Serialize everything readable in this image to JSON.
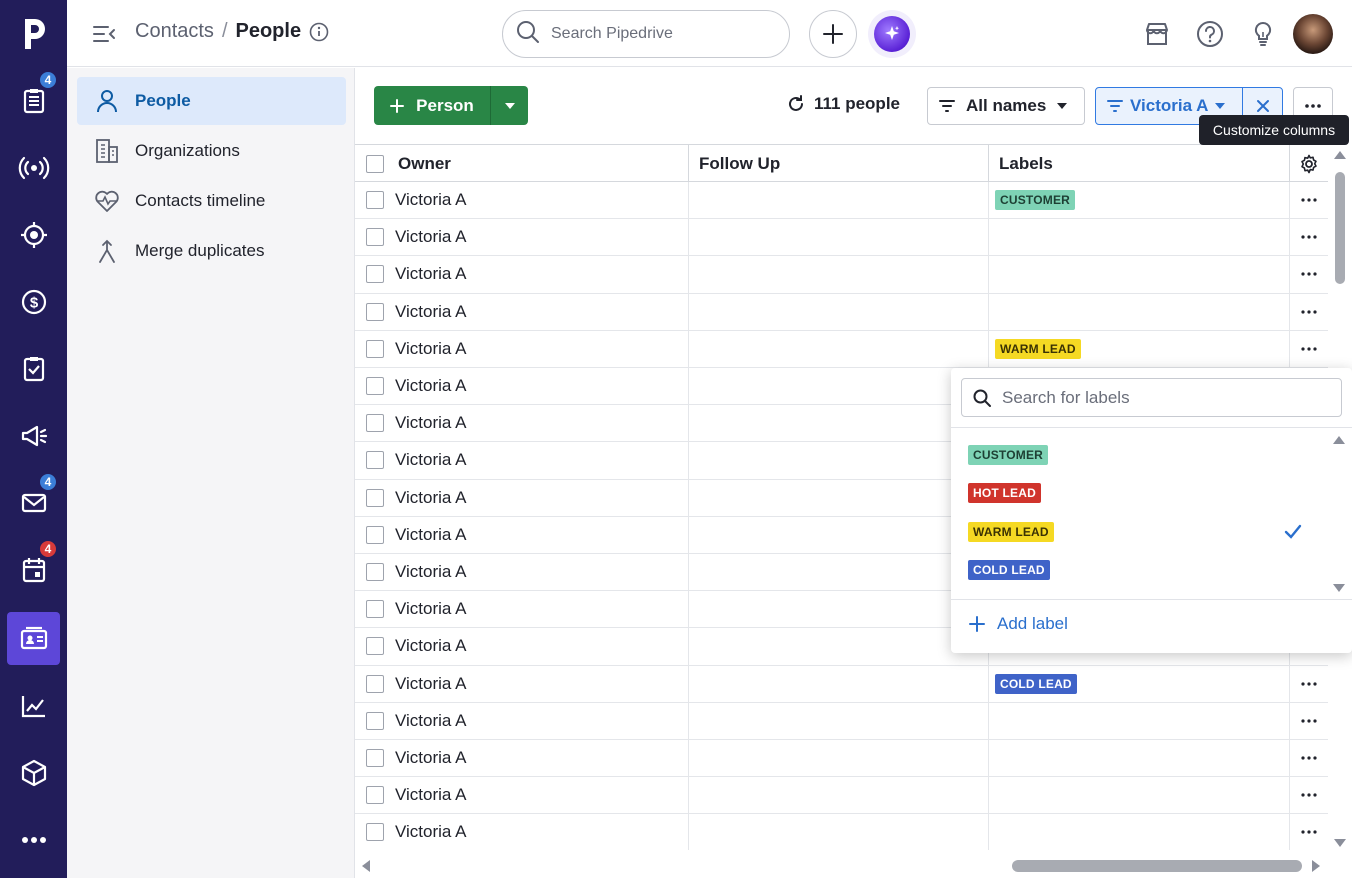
{
  "header": {
    "breadcrumb_parent": "Contacts",
    "breadcrumb_sep": "/",
    "breadcrumb_current": "People",
    "search_placeholder": "Search Pipedrive"
  },
  "rail": {
    "badges": {
      "activities": "4",
      "mail": "4",
      "calendar": "4"
    }
  },
  "sidebar": {
    "items": [
      {
        "label": "People",
        "icon": "person-icon"
      },
      {
        "label": "Organizations",
        "icon": "building-icon"
      },
      {
        "label": "Contacts timeline",
        "icon": "heartbeat-icon"
      },
      {
        "label": "Merge duplicates",
        "icon": "merge-icon"
      }
    ]
  },
  "toolbar": {
    "add_label": "Person",
    "count_label": "111 people",
    "names_filter": "All names",
    "owner_filter": "Victoria A",
    "tooltip": "Customize columns"
  },
  "table": {
    "columns": [
      "Owner",
      "Follow Up",
      "Labels"
    ],
    "rows": [
      {
        "owner": "Victoria A",
        "label": "CUSTOMER"
      },
      {
        "owner": "Victoria A",
        "label": ""
      },
      {
        "owner": "Victoria A",
        "label": ""
      },
      {
        "owner": "Victoria A",
        "label": ""
      },
      {
        "owner": "Victoria A",
        "label": "WARM LEAD"
      },
      {
        "owner": "Victoria A",
        "label": ""
      },
      {
        "owner": "Victoria A",
        "label": ""
      },
      {
        "owner": "Victoria A",
        "label": ""
      },
      {
        "owner": "Victoria A",
        "label": ""
      },
      {
        "owner": "Victoria A",
        "label": ""
      },
      {
        "owner": "Victoria A",
        "label": ""
      },
      {
        "owner": "Victoria A",
        "label": ""
      },
      {
        "owner": "Victoria A",
        "label": ""
      },
      {
        "owner": "Victoria A",
        "label": "COLD LEAD"
      },
      {
        "owner": "Victoria A",
        "label": ""
      },
      {
        "owner": "Victoria A",
        "label": ""
      },
      {
        "owner": "Victoria A",
        "label": ""
      },
      {
        "owner": "Victoria A",
        "label": ""
      }
    ]
  },
  "label_styles": {
    "CUSTOMER": {
      "bg": "#7ed3b5",
      "fg": "#1d3f33"
    },
    "HOT LEAD": {
      "bg": "#d0342c",
      "fg": "#ffffff"
    },
    "WARM LEAD": {
      "bg": "#f5d923",
      "fg": "#3a3204"
    },
    "COLD LEAD": {
      "bg": "#3f63c8",
      "fg": "#ffffff"
    }
  },
  "label_popup": {
    "search_placeholder": "Search for labels",
    "options": [
      {
        "label": "CUSTOMER",
        "checked": false
      },
      {
        "label": "HOT LEAD",
        "checked": false
      },
      {
        "label": "WARM LEAD",
        "checked": true
      },
      {
        "label": "COLD LEAD",
        "checked": false
      }
    ],
    "add_label": "Add label"
  },
  "colors": {
    "rail_bg": "#221d5a",
    "rail_active": "#5d47d8",
    "primary_green": "#298646",
    "link_blue": "#2a6fcd"
  }
}
